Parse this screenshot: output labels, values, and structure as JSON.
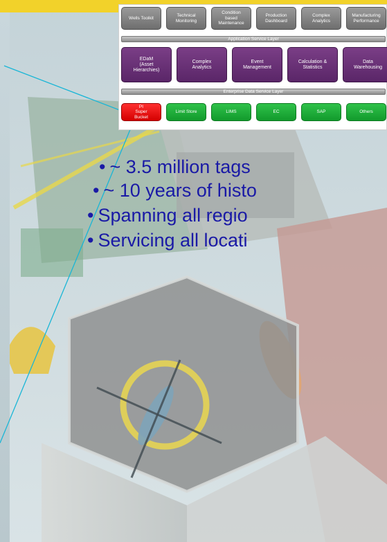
{
  "diagram": {
    "application_tiles": [
      "Wells Toolkit",
      "Technical\nMonitoring",
      "Condition\nbased\nMaintenance",
      "Production\nDashboard",
      "Complex\nAnalytics",
      "Manufacturing\nPerformance"
    ],
    "application_layer_label": "Application Service Layer",
    "service_tiles": [
      "EDaM\n(Asset\nHierarchies)",
      "Complex\nAnalytics",
      "Event\nManagement",
      "Calculation &\nStatistics",
      "Data\nWarehousing"
    ],
    "enterprise_layer_label": "Enterprise Data Service Layer",
    "data_tiles": [
      "PI\nSuper\nBucket",
      "Limit Store",
      "LIMS",
      "EC",
      "SAP",
      "Others"
    ]
  },
  "bullets": [
    "~ 3.5 million tags",
    "~ 10 years of histo",
    "Spanning all regio",
    "Servicing all locati"
  ],
  "colors": {
    "bullet_text": "#1a1aa6",
    "connector": "#19b6d6",
    "highlight_tile": "#e00000",
    "data_tile": "#1aaa36",
    "service_tile": "#652d73",
    "app_tile": "#808080"
  }
}
